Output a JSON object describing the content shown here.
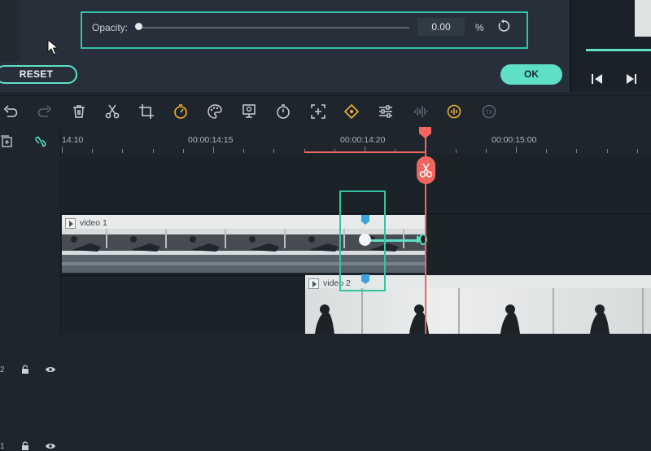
{
  "opacity": {
    "label": "Opacity:",
    "value": "0.00",
    "unit": "%",
    "slider_fraction": 0.0
  },
  "buttons": {
    "reset": "RESET",
    "ok": "OK"
  },
  "timeline": {
    "ruler_labels": [
      "14:10",
      "00:00:14:15",
      "00:00:14:20",
      "00:00:15:00"
    ],
    "tracks": [
      {
        "number": "2",
        "clip_title": "video 1"
      },
      {
        "number": "1",
        "clip_title": "video 2"
      }
    ]
  },
  "colors": {
    "accent": "#5fe0c5",
    "playhead": "#f0665f",
    "selection": "#33c4a6",
    "panel": "#27303a"
  },
  "icons": {
    "toolbar": [
      "undo-icon",
      "redo-icon",
      "delete-icon",
      "cut-icon",
      "crop-icon",
      "speed-icon",
      "color-icon",
      "green-screen-icon",
      "duration-icon",
      "stabilize-icon",
      "keyframe-icon",
      "adjust-icon",
      "audio-icon",
      "speech-icon",
      "tts-icon"
    ]
  }
}
